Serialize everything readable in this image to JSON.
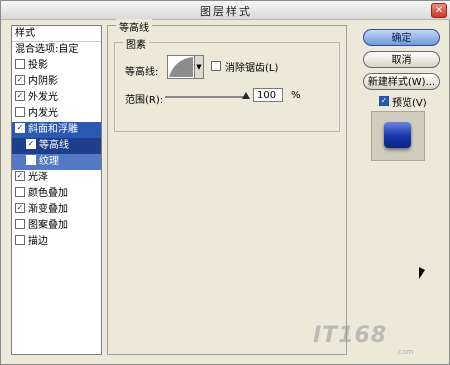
{
  "window": {
    "title": "图层样式",
    "close_glyph": "✕"
  },
  "style_list": {
    "header": "样式",
    "blend_options": "混合选项:自定",
    "items": [
      {
        "label": "投影",
        "checked": false
      },
      {
        "label": "内阴影",
        "checked": true
      },
      {
        "label": "外发光",
        "checked": true
      },
      {
        "label": "内发光",
        "checked": false
      },
      {
        "label": "斜面和浮雕",
        "checked": true
      },
      {
        "label": "等高线",
        "checked": true
      },
      {
        "label": "纹理",
        "checked": false
      },
      {
        "label": "光泽",
        "checked": true
      },
      {
        "label": "颜色叠加",
        "checked": false
      },
      {
        "label": "渐变叠加",
        "checked": true
      },
      {
        "label": "图案叠加",
        "checked": false
      },
      {
        "label": "描边",
        "checked": false
      }
    ]
  },
  "panel": {
    "group_title": "等高线",
    "subgroup_title": "图素",
    "contour_label": "等高线:",
    "anti_alias_label": "消除锯齿(L)",
    "anti_alias_checked": false,
    "range_label": "范围(R):",
    "range_value": "100",
    "range_unit": "%",
    "range_fraction": 1.0
  },
  "buttons": {
    "ok": "确定",
    "cancel": "取消",
    "new_style": "新建样式(W)...",
    "preview_label": "预览(V)",
    "preview_checked": true
  },
  "watermark": {
    "text": "IT168",
    "sub": ".com"
  },
  "colors": {
    "selection": "#2b59b1",
    "preview_swatch": "#1535a8"
  },
  "check_glyph": "✓"
}
